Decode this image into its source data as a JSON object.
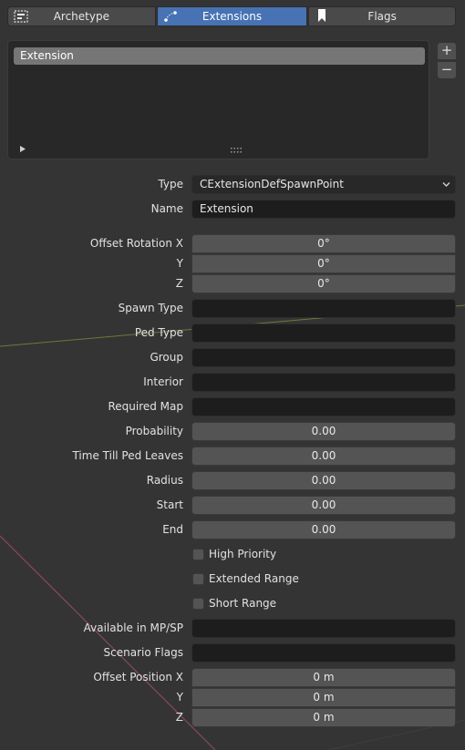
{
  "tabs": [
    {
      "label": "Archetype",
      "icon": "archetype-icon",
      "active": false
    },
    {
      "label": "Extensions",
      "icon": "extensions-icon",
      "active": true
    },
    {
      "label": "Flags",
      "icon": "bookmark-icon",
      "active": false
    }
  ],
  "extension_list": {
    "items": [
      "Extension"
    ],
    "add_label": "+",
    "remove_label": "−"
  },
  "properties": {
    "type": {
      "label": "Type",
      "value": "CExtensionDefSpawnPoint"
    },
    "name": {
      "label": "Name",
      "value": "Extension"
    },
    "offset_rotation": {
      "label_x": "Offset Rotation X",
      "label_y": "Y",
      "label_z": "Z",
      "x": "0°",
      "y": "0°",
      "z": "0°"
    },
    "spawn_type": {
      "label": "Spawn Type",
      "value": ""
    },
    "ped_type": {
      "label": "Ped Type",
      "value": ""
    },
    "group": {
      "label": "Group",
      "value": ""
    },
    "interior": {
      "label": "Interior",
      "value": ""
    },
    "required_map": {
      "label": "Required Map",
      "value": ""
    },
    "probability": {
      "label": "Probability",
      "value": "0.00"
    },
    "time_till_ped_leaves": {
      "label": "Time Till Ped Leaves",
      "value": "0.00"
    },
    "radius": {
      "label": "Radius",
      "value": "0.00"
    },
    "start": {
      "label": "Start",
      "value": "0.00"
    },
    "end": {
      "label": "End",
      "value": "0.00"
    },
    "high_priority": {
      "label": "High Priority",
      "checked": false
    },
    "extended_range": {
      "label": "Extended Range",
      "checked": false
    },
    "short_range": {
      "label": "Short Range",
      "checked": false
    },
    "available_in_mp_sp": {
      "label": "Available in MP/SP",
      "value": ""
    },
    "scenario_flags": {
      "label": "Scenario Flags",
      "value": ""
    },
    "offset_position": {
      "label_x": "Offset Position X",
      "label_y": "Y",
      "label_z": "Z",
      "x": "0 m",
      "y": "0 m",
      "z": "0 m"
    }
  },
  "colors": {
    "background": "#343434",
    "active_tab": "#4772b3",
    "field_dark": "#1d1d1d",
    "number_field": "#545454"
  }
}
